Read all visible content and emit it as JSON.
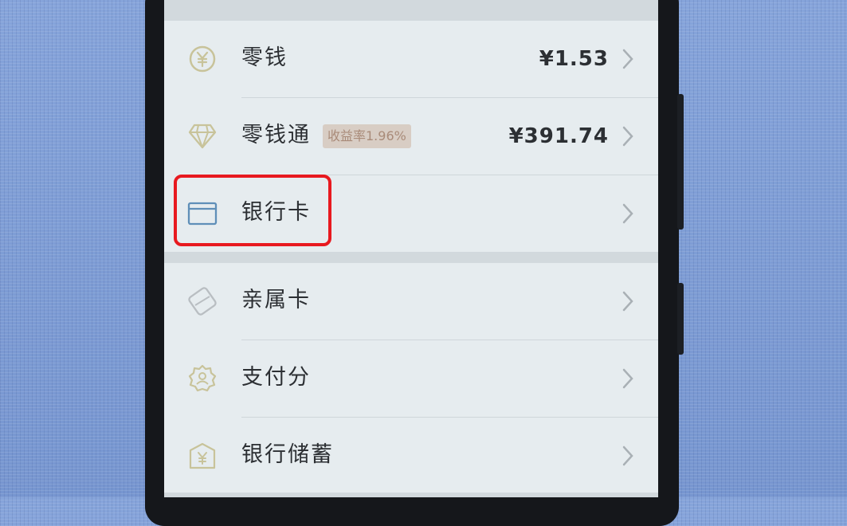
{
  "wallet_menu": {
    "items": [
      {
        "id": "change",
        "label": "零钱",
        "value": "¥1.53",
        "icon": "yuan-coin-icon"
      },
      {
        "id": "lingqiantong",
        "label": "零钱通",
        "badge": "收益率1.96%",
        "value": "¥391.74",
        "icon": "diamond-icon"
      },
      {
        "id": "bank-card",
        "label": "银行卡",
        "icon": "bank-card-icon",
        "highlighted": true
      },
      {
        "id": "family-card",
        "label": "亲属卡",
        "icon": "family-card-icon"
      },
      {
        "id": "pay-score",
        "label": "支付分",
        "icon": "gear-badge-icon"
      },
      {
        "id": "bank-savings",
        "label": "银行储蓄",
        "icon": "bank-building-icon"
      }
    ]
  },
  "colors": {
    "highlight_border": "#e8191f",
    "icon_color": "#c8c39a",
    "bank_icon_color": "#5f8fb8",
    "text": "#2c2f33",
    "badge_bg": "#d8cdc4",
    "badge_text": "#a98b79"
  }
}
